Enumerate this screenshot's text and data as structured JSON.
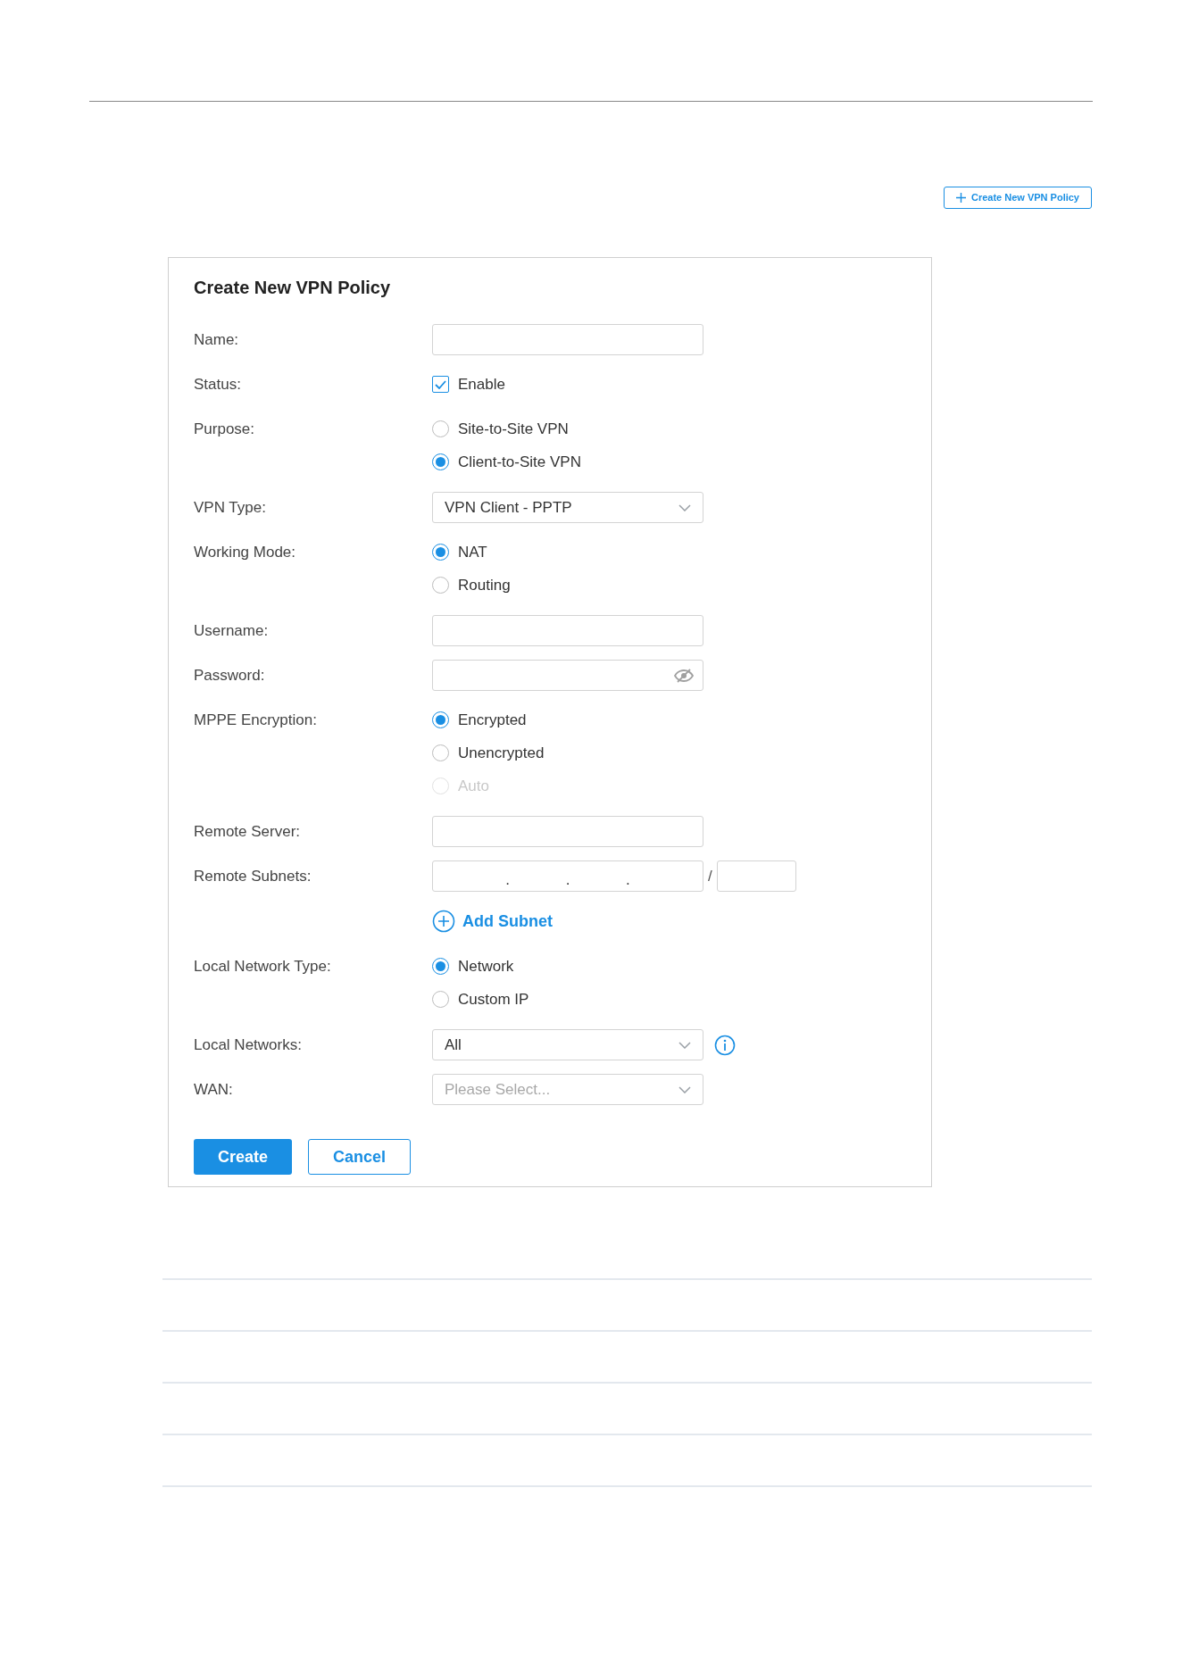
{
  "toolbar": {
    "create_button": "Create New VPN Policy"
  },
  "dialog": {
    "title": "Create New VPN Policy",
    "fields": [
      {
        "kind": "text",
        "label": "Name:"
      },
      {
        "kind": "checkbox",
        "label": "Status:",
        "option": "Enable",
        "checked": true
      },
      {
        "kind": "radio",
        "label": "Purpose:",
        "options": [
          {
            "label": "Site-to-Site VPN",
            "selected": false,
            "disabled": false
          },
          {
            "label": "Client-to-Site VPN",
            "selected": true,
            "disabled": false
          }
        ]
      },
      {
        "kind": "select",
        "label": "VPN Type:",
        "value": "VPN Client - PPTP"
      },
      {
        "kind": "radio",
        "label": "Working Mode:",
        "options": [
          {
            "label": "NAT",
            "selected": true,
            "disabled": false
          },
          {
            "label": "Routing",
            "selected": false,
            "disabled": false
          }
        ]
      },
      {
        "kind": "text",
        "label": "Username:"
      },
      {
        "kind": "password",
        "label": "Password:"
      },
      {
        "kind": "radio",
        "label": "MPPE Encryption:",
        "options": [
          {
            "label": "Encrypted",
            "selected": true,
            "disabled": false
          },
          {
            "label": "Unencrypted",
            "selected": false,
            "disabled": false
          },
          {
            "label": "Auto",
            "selected": false,
            "disabled": true
          }
        ]
      },
      {
        "kind": "text",
        "label": "Remote Server:"
      },
      {
        "kind": "subnet",
        "label": "Remote Subnets:",
        "dots": [
          ".",
          ".",
          "."
        ],
        "slash": "/"
      },
      {
        "kind": "link",
        "label_link": "Add Subnet"
      },
      {
        "kind": "radio",
        "label": "Local Network Type:",
        "options": [
          {
            "label": "Network",
            "selected": true,
            "disabled": false
          },
          {
            "label": "Custom IP",
            "selected": false,
            "disabled": false
          }
        ]
      },
      {
        "kind": "select",
        "label": "Local Networks:",
        "value": "All",
        "info": true
      },
      {
        "kind": "select",
        "label": "WAN:",
        "placeholder": "Please Select..."
      }
    ],
    "buttons": [
      {
        "kind": "primary",
        "label": "Create"
      },
      {
        "kind": "secondary",
        "label": "Cancel"
      }
    ]
  }
}
